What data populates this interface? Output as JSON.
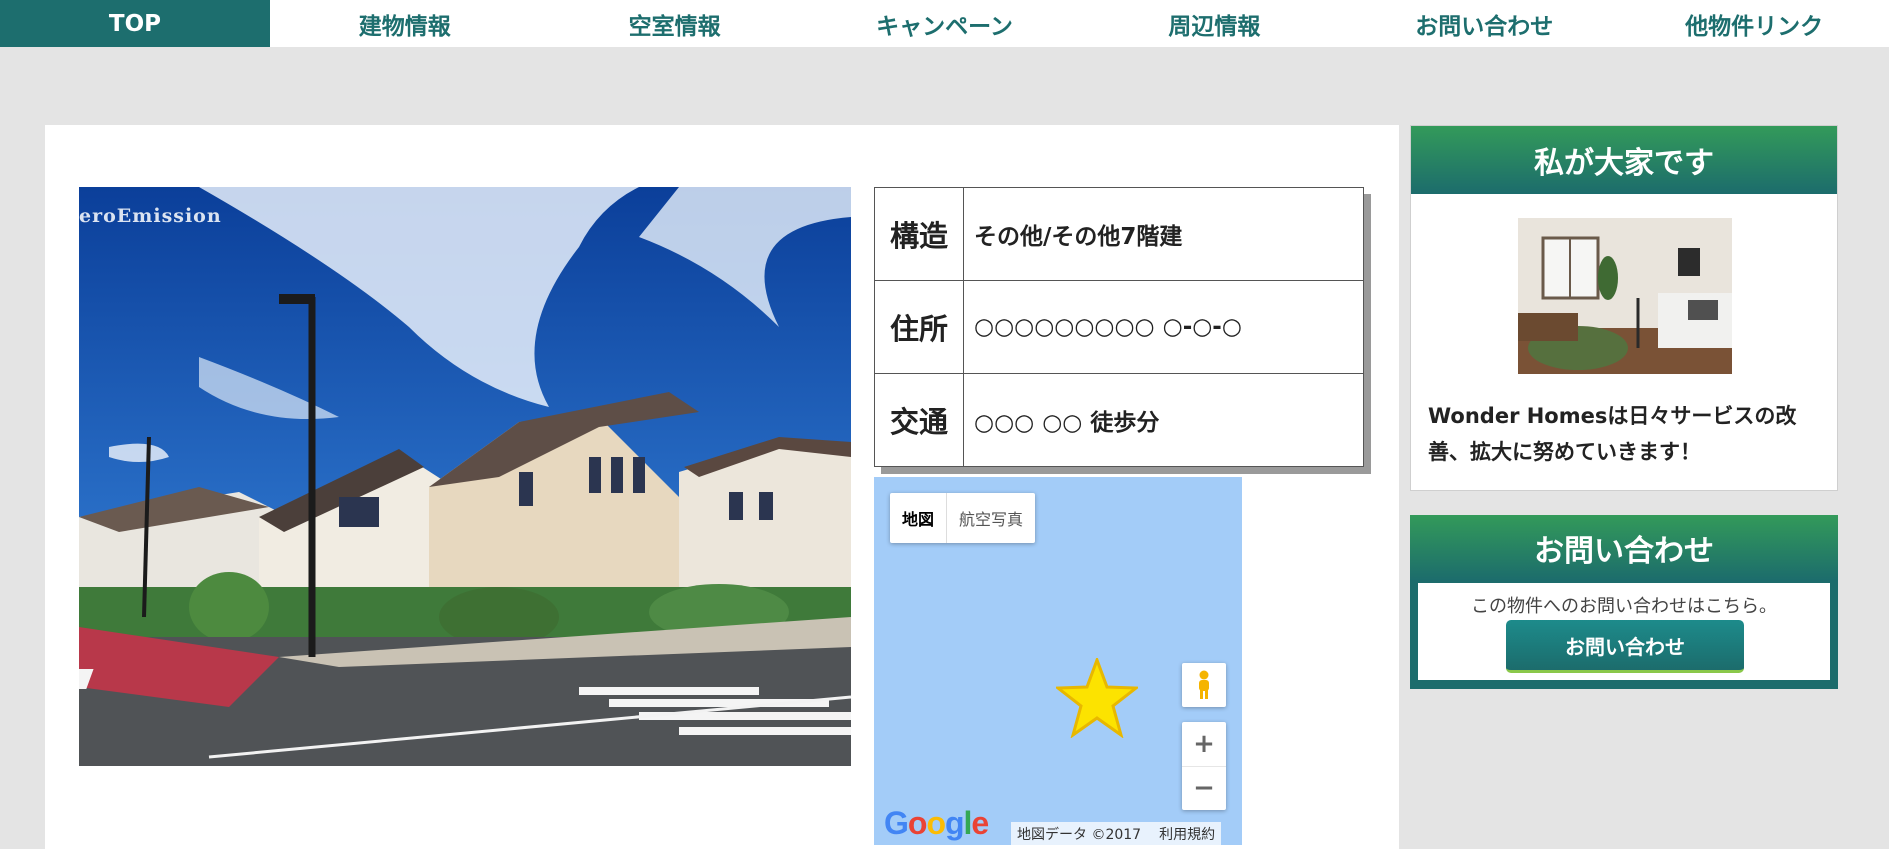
{
  "nav": {
    "items": [
      "TOP",
      "建物情報",
      "空室情報",
      "キャンペーン",
      "周辺情報",
      "お問い合わせ",
      "他物件リンク"
    ]
  },
  "photo": {
    "watermark": "eroEmission"
  },
  "property": {
    "rows": [
      {
        "label": "構造",
        "value": "その他/その他7階建"
      },
      {
        "label": "住所",
        "value": "○○○○○○○○○ ○-○-○"
      },
      {
        "label": "交通",
        "value": "○○○ ○○ 徒歩分"
      }
    ]
  },
  "map": {
    "type_map": "地図",
    "type_satellite": "航空写真",
    "zoom_in": "+",
    "zoom_out": "−",
    "logo": "Google",
    "attribution": "地図データ ©2017",
    "terms": "利用規約"
  },
  "sidebar": {
    "owner": {
      "title": "私が大家です",
      "text": "Wonder Homesは日々サービスの改善、拡大に努めていきます！"
    },
    "contact": {
      "title": "お問い合わせ",
      "text": "この物件へのお問い合わせはこちら。",
      "button": "お問い合わせ"
    }
  },
  "colors": {
    "accent": "#1d6e6e",
    "map_water": "#a3ccf8",
    "marker": "#fce300"
  }
}
